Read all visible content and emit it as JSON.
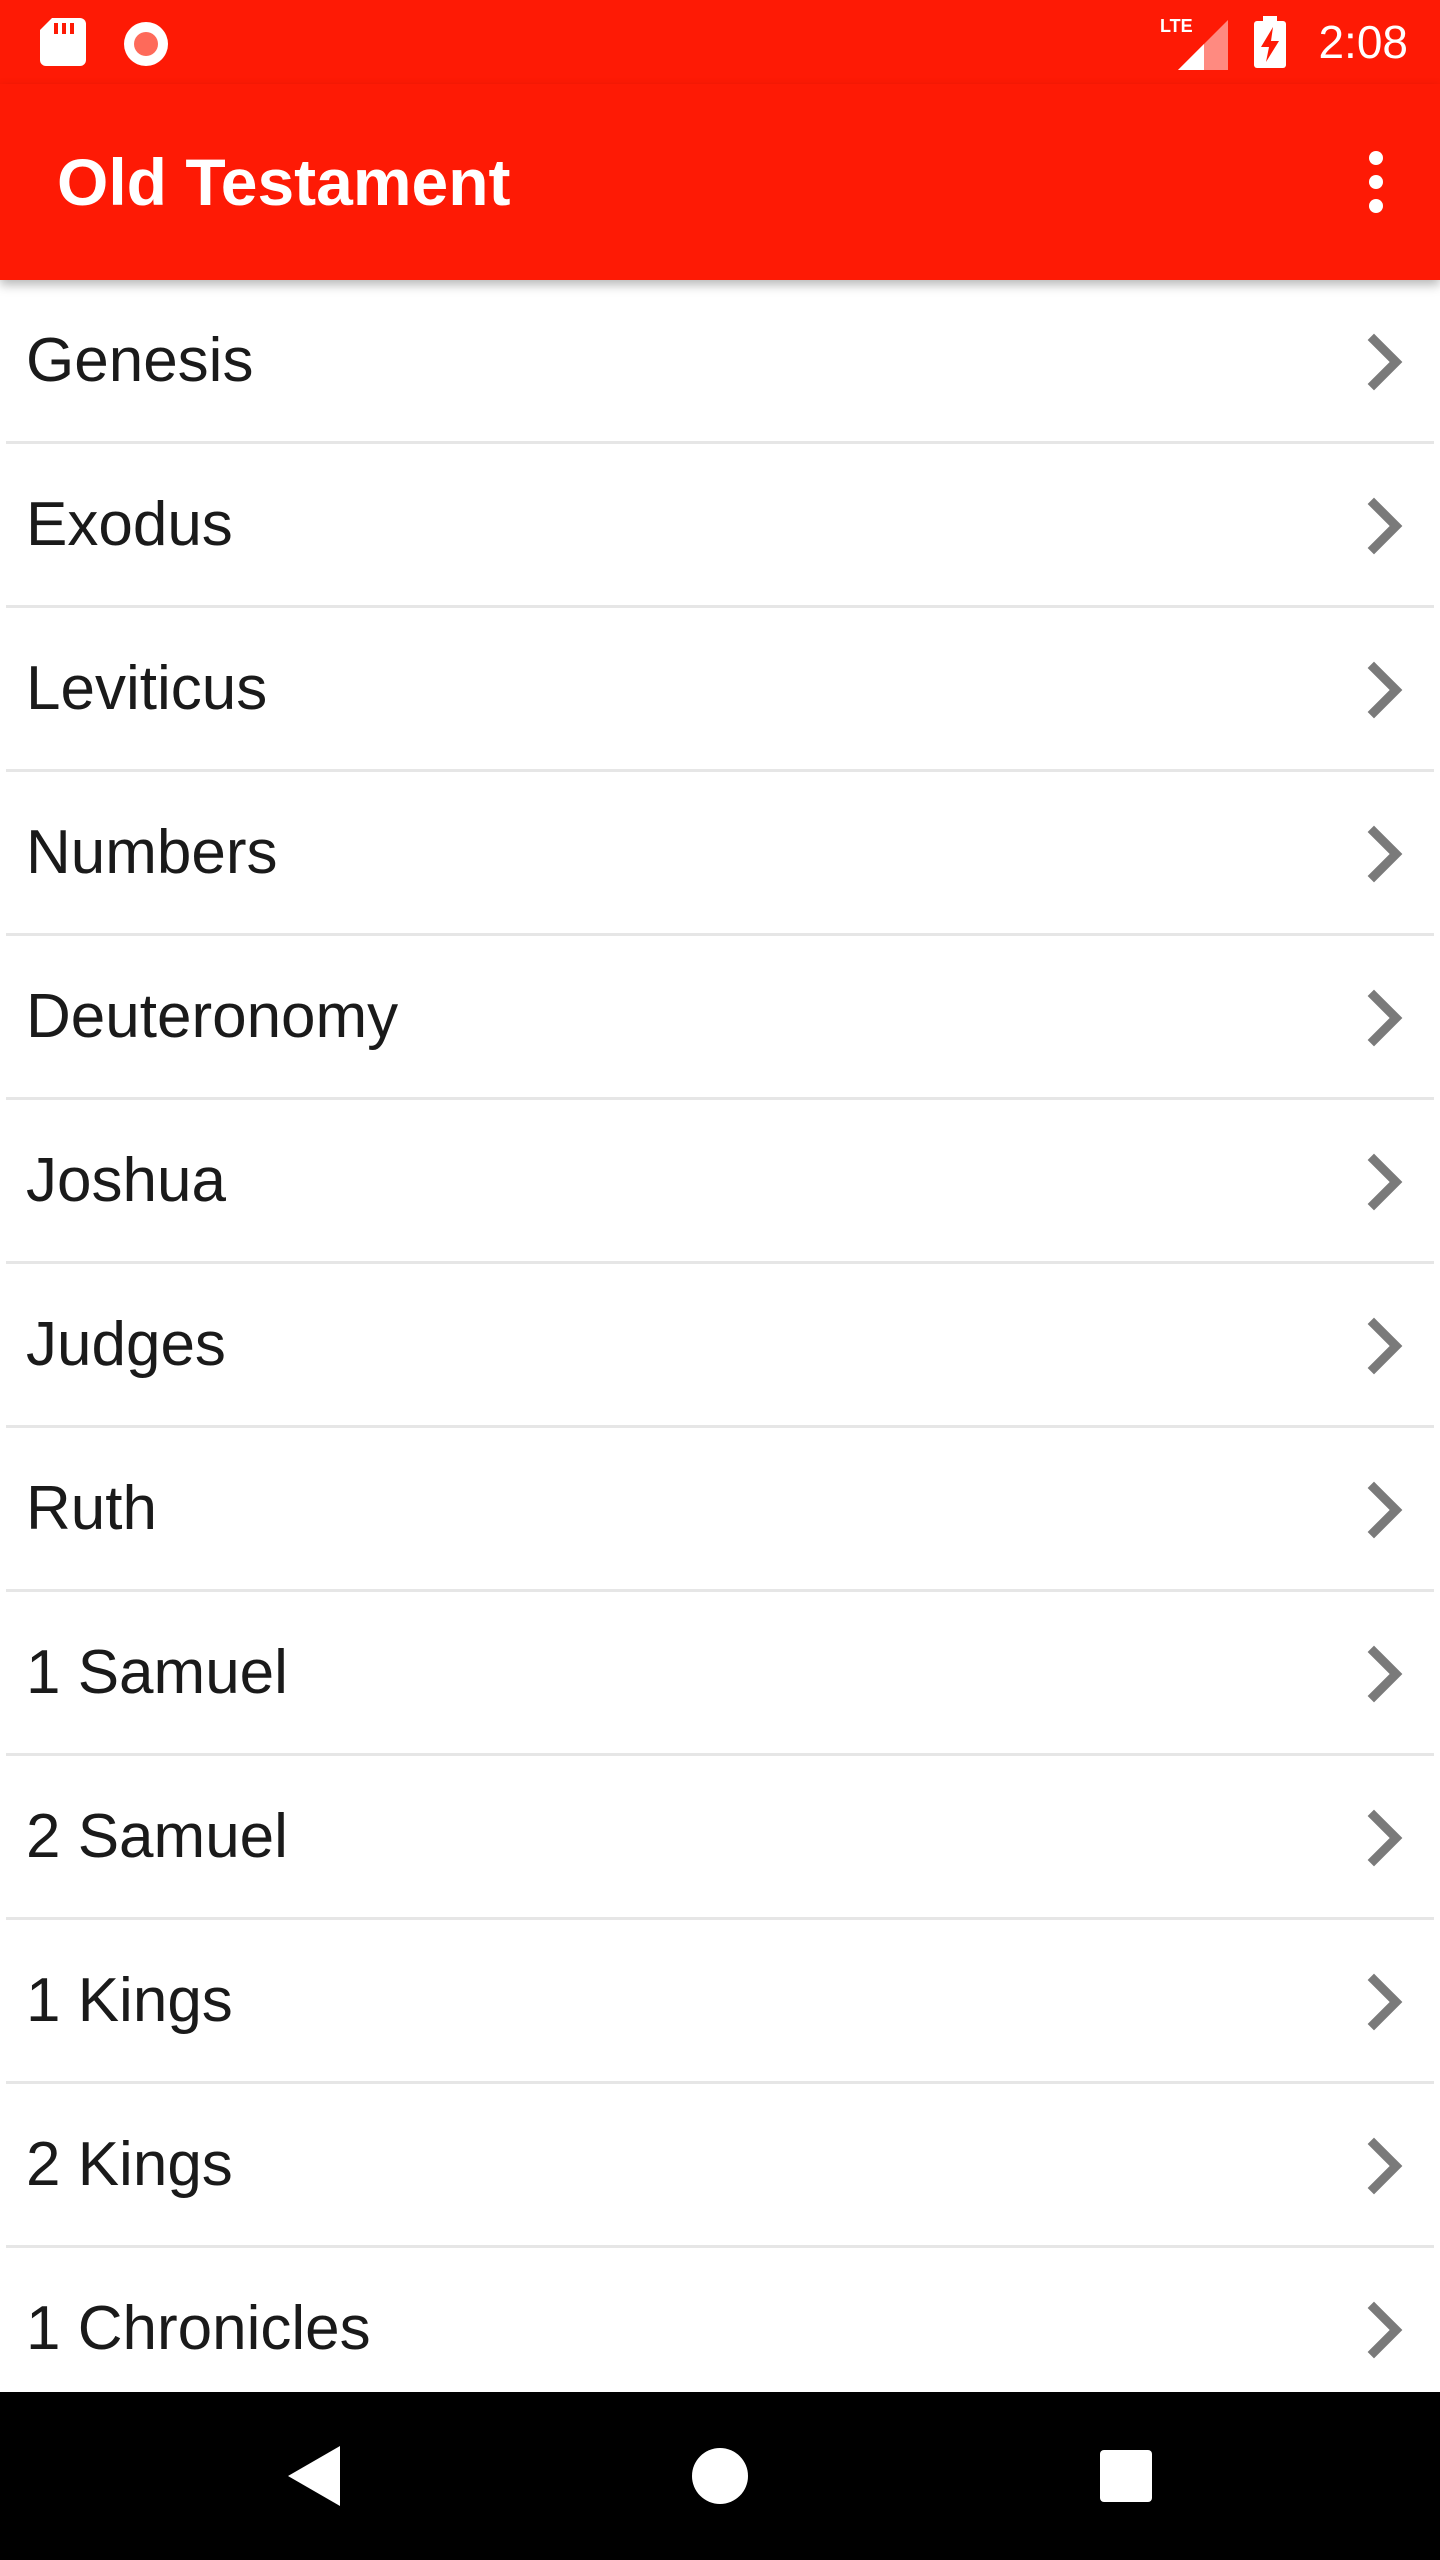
{
  "status_bar": {
    "time": "2:08",
    "network_label": "LTE",
    "icons": [
      "sd-card-icon",
      "record-icon",
      "lte-signal-icon",
      "battery-charging-icon"
    ]
  },
  "app_bar": {
    "title": "Old Testament",
    "menu_icon": "more-vert-icon"
  },
  "books": [
    {
      "label": "Genesis"
    },
    {
      "label": "Exodus"
    },
    {
      "label": "Leviticus"
    },
    {
      "label": "Numbers"
    },
    {
      "label": "Deuteronomy"
    },
    {
      "label": "Joshua"
    },
    {
      "label": "Judges"
    },
    {
      "label": "Ruth"
    },
    {
      "label": "1 Samuel"
    },
    {
      "label": "2 Samuel"
    },
    {
      "label": "1 Kings"
    },
    {
      "label": "2 Kings"
    },
    {
      "label": "1 Chronicles"
    }
  ],
  "nav_bar": {
    "icons": [
      "back-icon",
      "home-icon",
      "recents-icon"
    ]
  },
  "colors": {
    "accent": "#fe1a05",
    "divider": "#e6e6e6",
    "chevron": "#7a7a7a",
    "nav_background": "#000000"
  }
}
